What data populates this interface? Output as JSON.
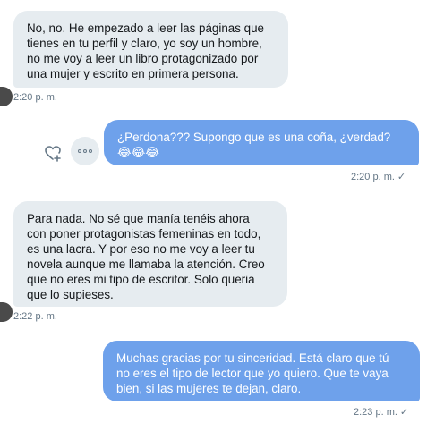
{
  "messages": [
    {
      "direction": "received",
      "text": "No, no. He empezado a leer las páginas que\ntienes en tu perfil y claro, yo soy un hombre,\nno me voy a leer un libro protagonizado por\nuna mujer y escrito en primera persona.",
      "time": "2:20 p. m."
    },
    {
      "direction": "sent",
      "text": "¿Perdona??? Supongo que es una coña, ¿verdad?\n😂😂😂",
      "time": "2:20 p. m."
    },
    {
      "direction": "received",
      "text": "Para nada. No sé que manía tenéis ahora\ncon poner protagonistas femeninas en todo,\nes una lacra. Y por eso no me voy a leer tu\nnovela aunque me llamaba la atención. Creo\nque no eres mi tipo de escritor. Solo queria\nque lo supieses.",
      "time": "2:22 p. m."
    },
    {
      "direction": "sent",
      "text": "Muchas gracias por tu sinceridad. Está claro que tú\nno eres el tipo de lector que yo quiero. Que te vaya\nbien, si las mujeres te dejan, claro.",
      "time": "2:23 p. m."
    }
  ],
  "icons": {
    "read_receipt": "✓",
    "like": "heart-plus-icon",
    "more": "more-dots-icon"
  },
  "colors": {
    "received_bubble": "#e6ecf0",
    "sent_bubble": "#6ea1eb",
    "timestamp": "#657786"
  }
}
